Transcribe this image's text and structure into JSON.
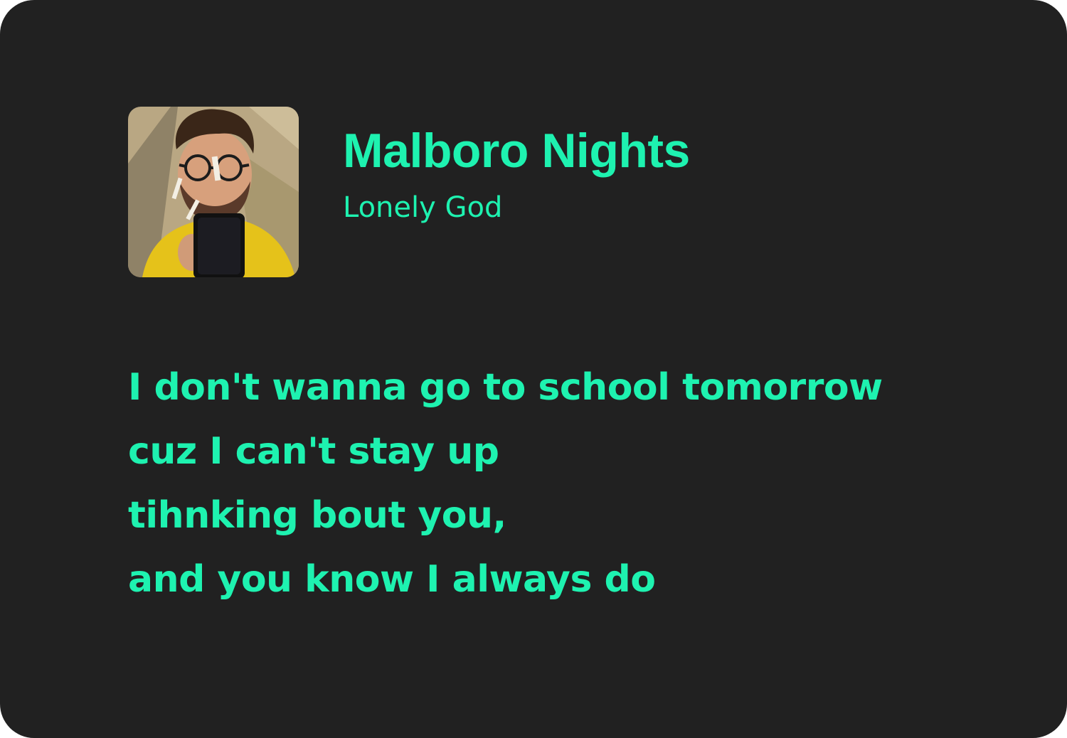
{
  "colors": {
    "background": "#212121",
    "accent": "#1ef2b0"
  },
  "track": {
    "title": "Malboro Nights",
    "artist": "Lonely God",
    "cover_art": "album-cover-photo"
  },
  "lyrics": [
    "I don't wanna go to school tomorrow",
    "cuz I can't stay up",
    "tihnking bout you,",
    "and you know I always do"
  ]
}
